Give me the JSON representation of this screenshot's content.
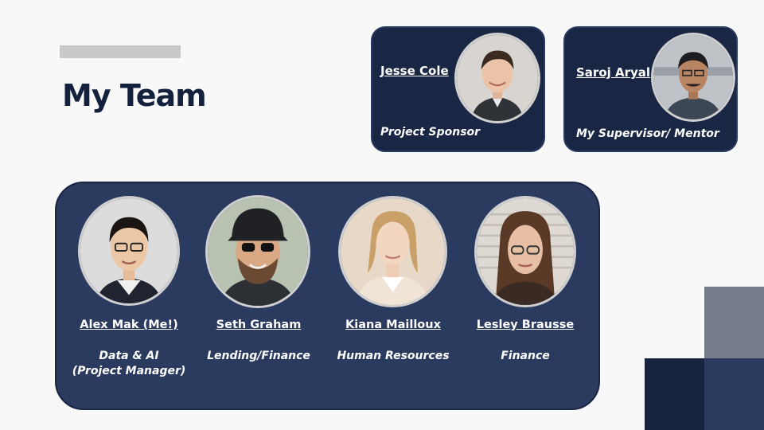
{
  "page": {
    "title": "My Team",
    "colors": {
      "navy_dark": "#1a2744",
      "navy_panel": "#2b3a5f",
      "title_text": "#14213d",
      "accent_gray": "#c9c9c9"
    }
  },
  "leaders": [
    {
      "name": "Jesse Cole",
      "role": "Project Sponsor",
      "photo": "portrait-photo"
    },
    {
      "name": "Saroj Aryal",
      "role": "My Supervisor/ Mentor",
      "photo": "portrait-photo"
    }
  ],
  "team": [
    {
      "name": "Alex Mak (Me!)",
      "role_line1": "Data & AI",
      "role_line2": "(Project Manager)",
      "photo": "portrait-photo"
    },
    {
      "name": "Seth Graham",
      "role_line1": "Lending/Finance",
      "role_line2": "",
      "photo": "portrait-photo"
    },
    {
      "name": "Kiana Mailloux",
      "role_line1": "Human Resources",
      "role_line2": "",
      "photo": "portrait-photo"
    },
    {
      "name": "Lesley Brausse",
      "role_line1": "Finance",
      "role_line2": "",
      "photo": "portrait-photo"
    }
  ]
}
